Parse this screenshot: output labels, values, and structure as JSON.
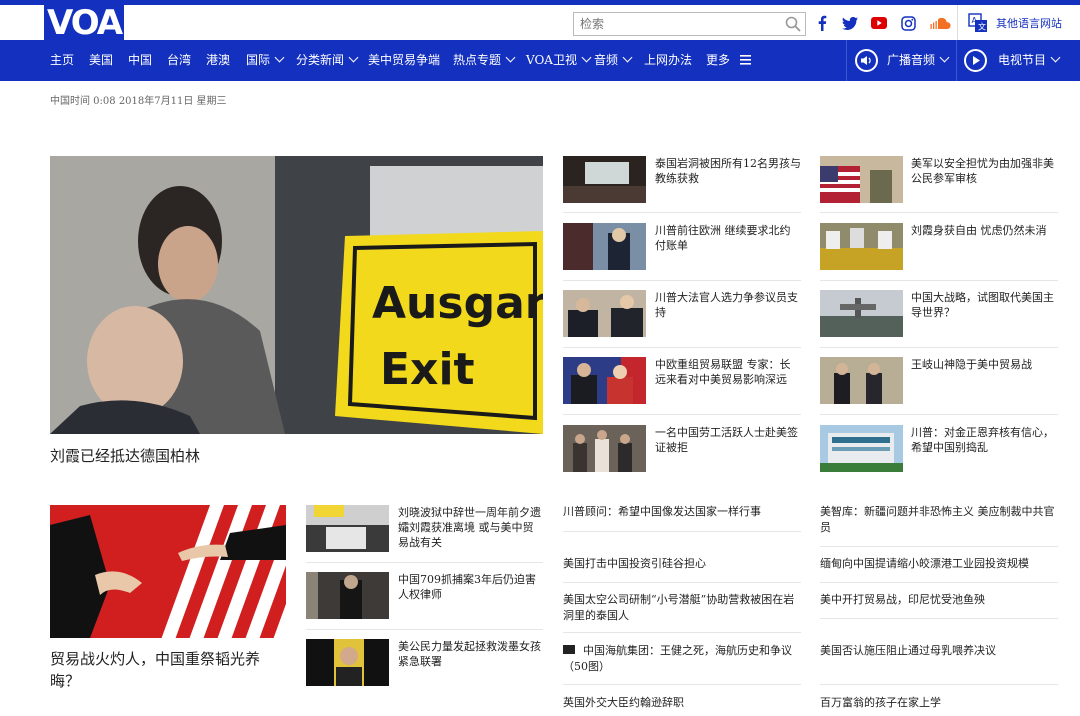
{
  "header": {
    "logo_text": "VOA",
    "search_placeholder": "检索",
    "social_icons": [
      "facebook-icon",
      "twitter-icon",
      "youtube-icon",
      "instagram-icon",
      "soundcloud-icon"
    ],
    "other_languages": "其他语言网站"
  },
  "nav": {
    "items": [
      "主页",
      "美国",
      "中国",
      "台湾",
      "港澳",
      "国际",
      "分类新闻",
      "美中贸易争端",
      "热点专题",
      "VOA卫视",
      "音频",
      "上网办法",
      "更多"
    ],
    "radio": "广播音频",
    "tv": "电视节目"
  },
  "date_line": "中国时间 0:08 2018年7月11日 星期三",
  "lead": {
    "title": "刘霞已经抵达德国柏林",
    "sign_line1": "Ausgar",
    "sign_line2": "Exit"
  },
  "middle_column": [
    "泰国岩洞被困所有12名男孩与教练获救",
    "川普前往欧洲 继续要求北约付账单",
    "川普大法官人选力争参议员支持",
    "中欧重组贸易联盟 专家：长远来看对中美贸易影响深远",
    "一名中国劳工活跃人士赴美签证被拒"
  ],
  "right_column": [
    "美军以安全担忧为由加强非美公民参军审核",
    "刘霞身获自由 忧虑仍然未消",
    "中国大战略，试图取代美国主导世界？",
    "王岐山神隐于美中贸易战",
    "川普：对金正恩弃核有信心，希望中国别捣乱"
  ],
  "second_lead": {
    "title": "贸易战火灼人，中国重祭韬光养晦？"
  },
  "second_small": [
    "刘晓波狱中辞世一周年前夕遗孀刘霞获准离境 或与美中贸易战有关",
    "中国709抓捕案3年后仍迫害人权律师",
    "美公民力量发起拯救泼墨女孩紧急联署"
  ],
  "text_links_left": [
    "川普顾问：希望中国像发达国家一样行事",
    "美国打击中国投资引硅谷担心",
    "美国太空公司研制“小号潜艇”协助营救被困在岩洞里的泰国人",
    "中国海航集团：王健之死，海航历史和争议（50图）",
    "英国外交大臣约翰逊辞职"
  ],
  "text_links_right": [
    "美智库：新疆问题并非恐怖主义 美应制裁中共官员",
    "缅甸向中国提请缩小皎漂港工业园投资规模",
    "美中开打贸易战，印尼忧受池鱼殃",
    "美国否认施压阻止通过母乳喂养决议",
    "百万富翁的孩子在家上学"
  ],
  "colors": {
    "brand_blue": "#1330bf"
  }
}
